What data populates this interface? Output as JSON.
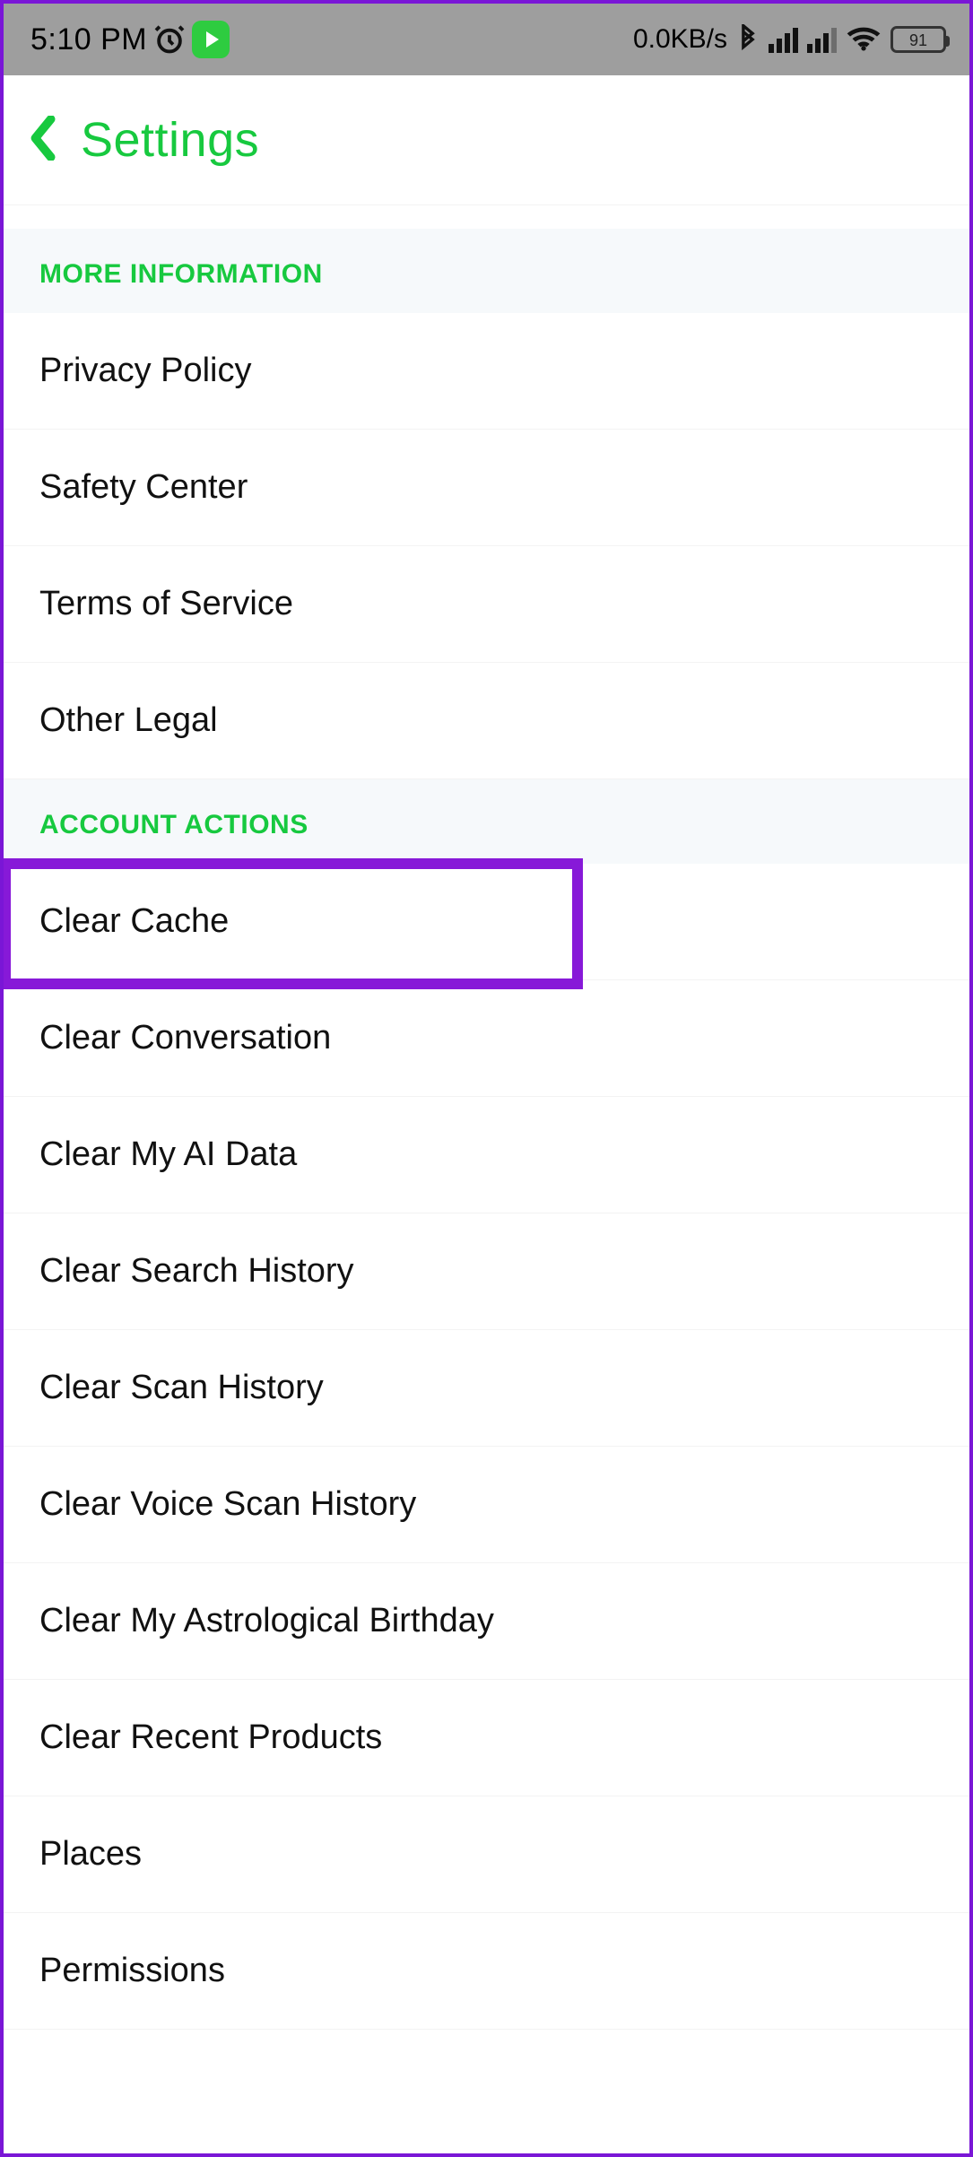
{
  "statusbar": {
    "time": "5:10 PM",
    "data_rate": "0.0KB/s",
    "battery_pct": "91"
  },
  "header": {
    "title": "Settings"
  },
  "sections": [
    {
      "title": "MORE INFORMATION",
      "items": [
        {
          "label": "Privacy Policy"
        },
        {
          "label": "Safety Center"
        },
        {
          "label": "Terms of Service"
        },
        {
          "label": "Other Legal"
        }
      ]
    },
    {
      "title": "ACCOUNT ACTIONS",
      "items": [
        {
          "label": "Clear Cache"
        },
        {
          "label": "Clear Conversation"
        },
        {
          "label": "Clear My AI Data"
        },
        {
          "label": "Clear Search History"
        },
        {
          "label": "Clear Scan History"
        },
        {
          "label": "Clear Voice Scan History"
        },
        {
          "label": "Clear My Astrological Birthday"
        },
        {
          "label": "Clear Recent Products"
        },
        {
          "label": "Places"
        },
        {
          "label": "Permissions"
        }
      ]
    }
  ],
  "highlight": {
    "section": 1,
    "item": 0
  }
}
